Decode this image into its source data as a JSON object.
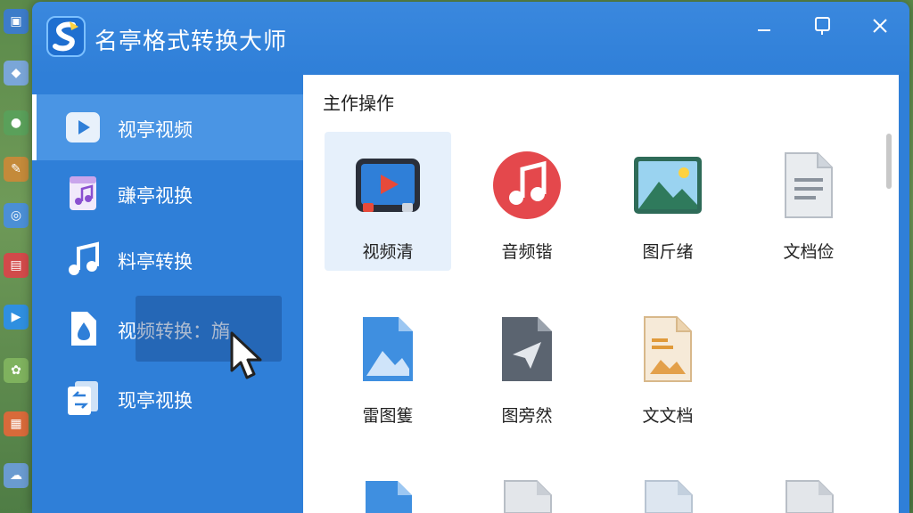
{
  "window": {
    "title": "名亭格式转换大师",
    "controls": {
      "minimize": "—",
      "maximize": "☐",
      "close": "✕"
    }
  },
  "sidebar": {
    "items": [
      {
        "label": "视亭视频",
        "icon": "video-play-icon",
        "active": true
      },
      {
        "label": "豏亭视换",
        "icon": "music-file-icon",
        "active": false
      },
      {
        "label": "料亭转换",
        "icon": "music-note-icon",
        "active": false
      },
      {
        "label": "视频转换：旓",
        "icon": "drop-file-icon",
        "active": false
      },
      {
        "label": "现亭视换",
        "icon": "convert-file-icon",
        "active": false
      }
    ]
  },
  "main": {
    "section_title": "主作操作",
    "tiles": [
      {
        "label": "视频清",
        "icon": "video-player-icon",
        "selected": true
      },
      {
        "label": "音频锴",
        "icon": "music-circle-icon",
        "selected": false
      },
      {
        "label": "图斤绪",
        "icon": "landscape-image-icon",
        "selected": false
      },
      {
        "label": "文档俭",
        "icon": "document-icon",
        "selected": false
      },
      {
        "label": "雷图篗",
        "icon": "image-file-icon",
        "selected": false
      },
      {
        "label": "图旁然",
        "icon": "send-file-icon",
        "selected": false
      },
      {
        "label": "文文档",
        "icon": "text-image-file-icon",
        "selected": false
      }
    ]
  },
  "colors": {
    "accent": "#2f7fd8",
    "active_item": "#4a95e4",
    "tile_selected": "#e6f0fb"
  }
}
